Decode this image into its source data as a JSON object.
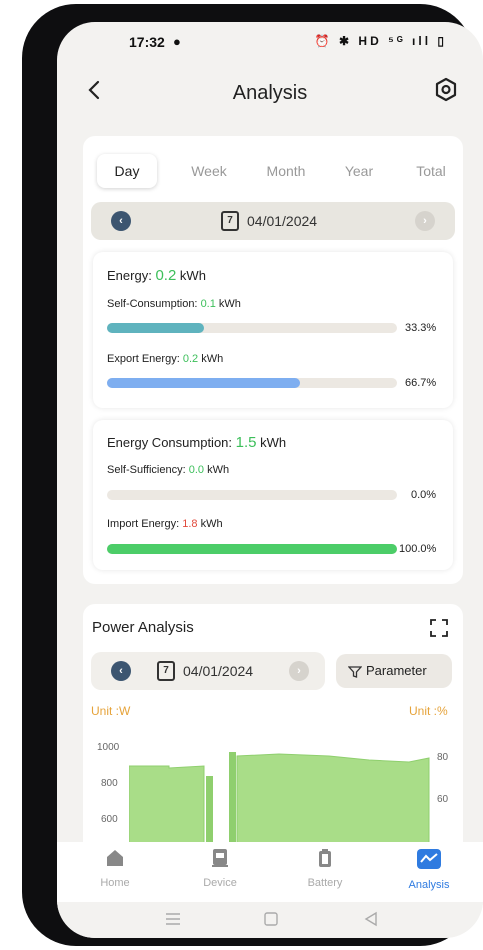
{
  "status_bar": {
    "time": "17:32",
    "right_icons": "⏰ ✱ HD ⁵ᴳ ıll ▯"
  },
  "header": {
    "title": "Analysis"
  },
  "period_tabs": [
    "Day",
    "Week",
    "Month",
    "Year",
    "Total"
  ],
  "active_tab": "Day",
  "date_selector": {
    "date": "04/01/2024",
    "calendar_day": "7"
  },
  "energy": {
    "label": "Energy:",
    "value": "0.2",
    "unit": "kWh",
    "self_consumption_label": "Self-Consumption:",
    "self_consumption_value": "0.1",
    "self_consumption_unit": "kWh",
    "self_consumption_pct": "33.3%",
    "self_consumption_fraction": 0.333,
    "export_label": "Export Energy:",
    "export_value": "0.2",
    "export_unit": "kWh",
    "export_pct": "66.7%",
    "export_fraction": 0.667
  },
  "consumption": {
    "label": "Energy Consumption:",
    "value": "1.5",
    "unit": "kWh",
    "self_sufficiency_label": "Self-Sufficiency:",
    "self_sufficiency_value": "0.0",
    "self_sufficiency_unit": "kWh",
    "self_sufficiency_pct": "0.0%",
    "self_sufficiency_fraction": 0.0,
    "import_label": "Import Energy:",
    "import_value": "1.8",
    "import_unit": "kWh",
    "import_pct": "100.0%",
    "import_fraction": 1.0
  },
  "power_analysis": {
    "title": "Power Analysis",
    "date": "04/01/2024",
    "calendar_day": "7",
    "parameter_label": "Parameter",
    "unit_left": "Unit :W",
    "unit_right": "Unit :%",
    "y_left_ticks": [
      "1000",
      "800",
      "600"
    ],
    "y_right_ticks": [
      "80",
      "60"
    ]
  },
  "bottom_nav": [
    {
      "label": "Home",
      "icon": "home-icon"
    },
    {
      "label": "Device",
      "icon": "device-icon"
    },
    {
      "label": "Battery",
      "icon": "battery-icon"
    },
    {
      "label": "Analysis",
      "icon": "analysis-icon",
      "active": true
    }
  ],
  "colors": {
    "green_value": "#3cbf5a",
    "red_value": "#e14a3c",
    "teal_bar": "#5fb3be",
    "blue_bar": "#7eaef0",
    "green_bar": "#4ccd68",
    "accent_blue": "#2f7be0",
    "unit_orange": "#e6a33a",
    "chart_fill": "#a9dd88"
  }
}
